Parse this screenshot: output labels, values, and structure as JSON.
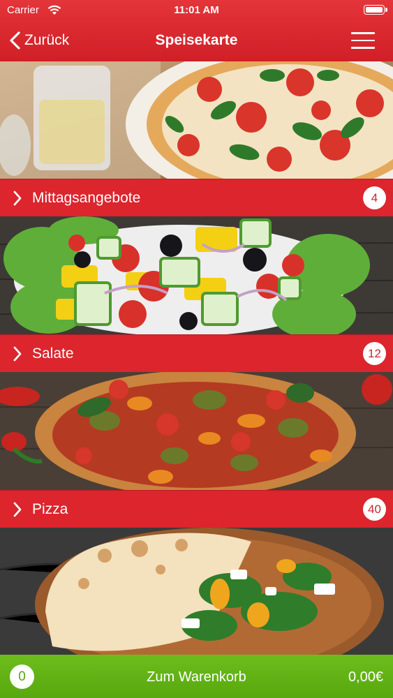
{
  "status_bar": {
    "carrier": "Carrier",
    "time": "11:01 AM"
  },
  "nav": {
    "back_label": "Zurück",
    "title": "Speisekarte"
  },
  "categories": [
    {
      "label": "Mittagsangebote",
      "count": "4",
      "photo": "pizza-margherita-photo"
    },
    {
      "label": "Salate",
      "count": "12",
      "photo": "greek-salad-photo"
    },
    {
      "label": "Pizza",
      "count": "40",
      "photo": "vegetable-pizza-photo"
    }
  ],
  "cart": {
    "count": "0",
    "label": "Zum Warenkorb",
    "total": "0,00€"
  },
  "colors": {
    "brand_red": "#dc252d",
    "cart_green": "#62b316"
  }
}
